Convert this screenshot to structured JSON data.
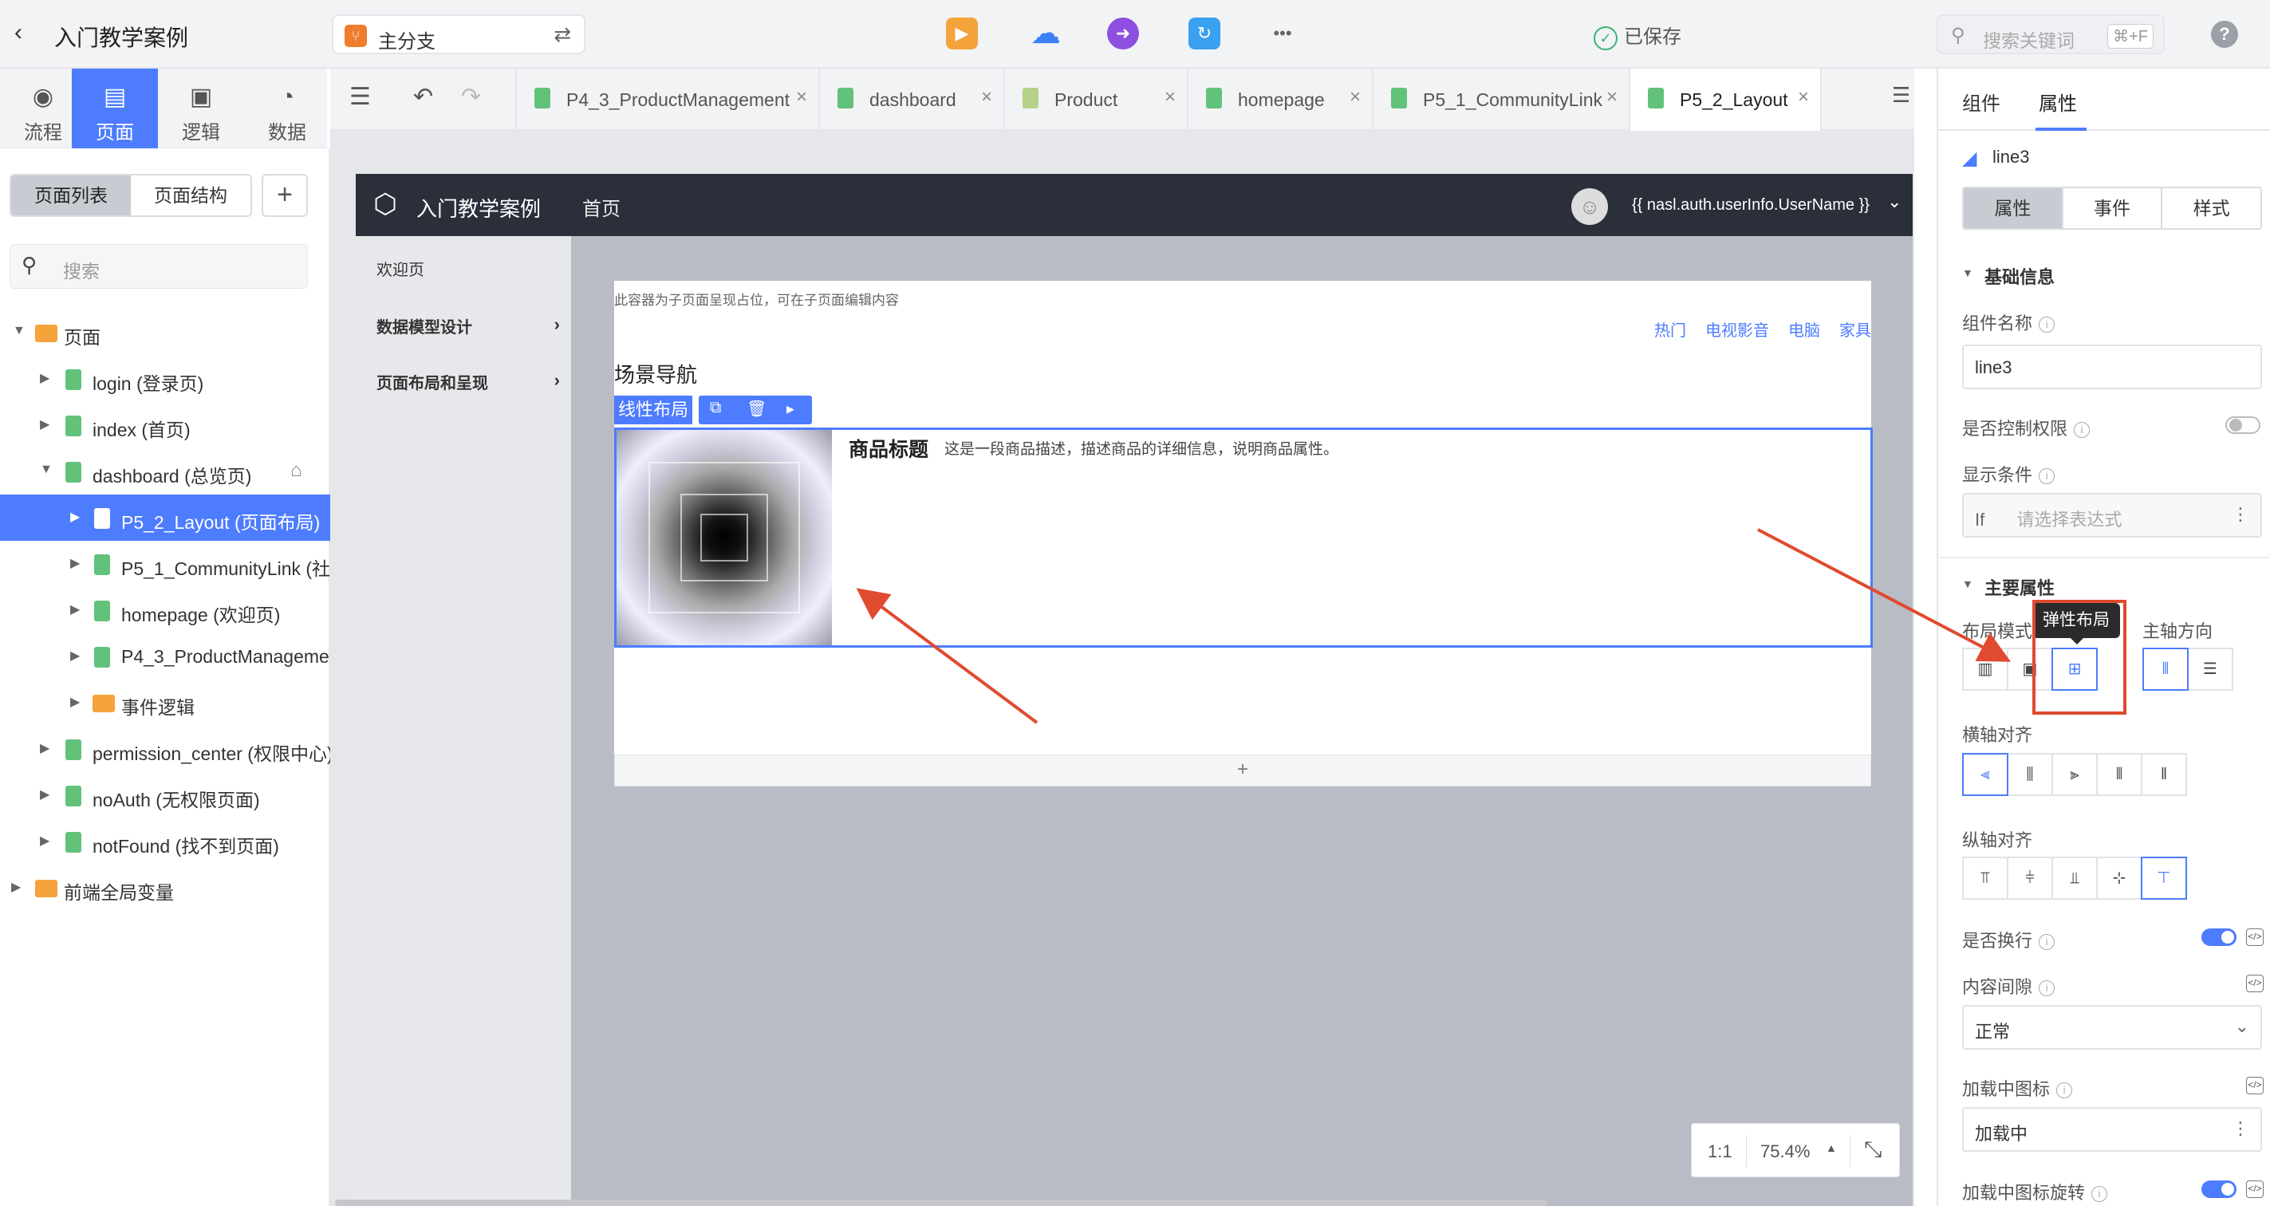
{
  "topbar": {
    "back": "‹",
    "title": "入门教学案例",
    "branch": "主分支",
    "branch_icon": "branch-icon",
    "more": "•••",
    "saved": "已保存",
    "search_placeholder": "搜索关键词",
    "search_shortcut": "⌘+F",
    "help": "?"
  },
  "leftnav": {
    "items": [
      {
        "label": "流程",
        "icon": "flow-icon"
      },
      {
        "label": "页面",
        "icon": "page-icon"
      },
      {
        "label": "逻辑",
        "icon": "logic-icon"
      },
      {
        "label": "数据",
        "icon": "data-icon"
      }
    ]
  },
  "leftpanel": {
    "tab_list": "页面列表",
    "tab_structure": "页面结构",
    "add": "+",
    "search_placeholder": "搜索",
    "tree": [
      {
        "label": "页面"
      },
      {
        "label": "login (登录页)"
      },
      {
        "label": "index (首页)"
      },
      {
        "label": "dashboard (总览页)"
      },
      {
        "label": "P5_2_Layout (页面布局)"
      },
      {
        "label": "P5_1_CommunityLink (社区"
      },
      {
        "label": "homepage (欢迎页)"
      },
      {
        "label": "P4_3_ProductManagemen"
      },
      {
        "label": "事件逻辑"
      },
      {
        "label": "permission_center (权限中心)"
      },
      {
        "label": "noAuth (无权限页面)"
      },
      {
        "label": "notFound (找不到页面)"
      },
      {
        "label": "前端全局变量"
      }
    ]
  },
  "tabs": [
    {
      "label": "P4_3_ProductManagement"
    },
    {
      "label": "dashboard"
    },
    {
      "label": "Product"
    },
    {
      "label": "homepage"
    },
    {
      "label": "P5_1_CommunityLink"
    },
    {
      "label": "P5_2_Layout"
    }
  ],
  "tab_close": "×",
  "app": {
    "name": "入门教学案例",
    "home": "首页",
    "username": "{{ nasl.auth.userInfo.UserName }}",
    "side": [
      {
        "label": "欢迎页"
      },
      {
        "label": "数据模型设计"
      },
      {
        "label": "页面布局和呈现"
      }
    ],
    "hint": "此容器为子页面呈现占位，可在子页面编辑内容",
    "links": [
      "热门",
      "电视影音",
      "电脑",
      "家具"
    ],
    "section_title": "场景导航",
    "layout_tag": "线性布局",
    "product_title": "商品标题",
    "product_desc": "这是一段商品描述，描述商品的详细信息，说明商品属性。",
    "add_row": "+"
  },
  "zoom": {
    "ratio": "1:1",
    "value": "75.4%"
  },
  "rightpanel": {
    "tab_components": "组件",
    "tab_properties": "属性",
    "component": "line3",
    "ptabs": [
      "属性",
      "事件",
      "样式"
    ],
    "section_basic": "基础信息",
    "name_label": "组件名称",
    "name_value": "line3",
    "perm_label": "是否控制权限",
    "cond_label": "显示条件",
    "cond_if": "If",
    "cond_placeholder": "请选择表达式",
    "section_main": "主要属性",
    "layout_mode": "布局模式",
    "main_axis": "主轴方向",
    "tooltip": "弹性布局",
    "h_align": "横轴对齐",
    "v_align": "纵轴对齐",
    "wrap": "是否换行",
    "gap": "内容间隙",
    "gap_value": "正常",
    "loading_icon": "加载中图标",
    "loading_value": "加载中",
    "loading_rotate": "加载中图标旋转"
  },
  "colors": {
    "accent": "#4d7cfe",
    "annotation": "#e04a2f",
    "header": "#2a2f3a"
  }
}
